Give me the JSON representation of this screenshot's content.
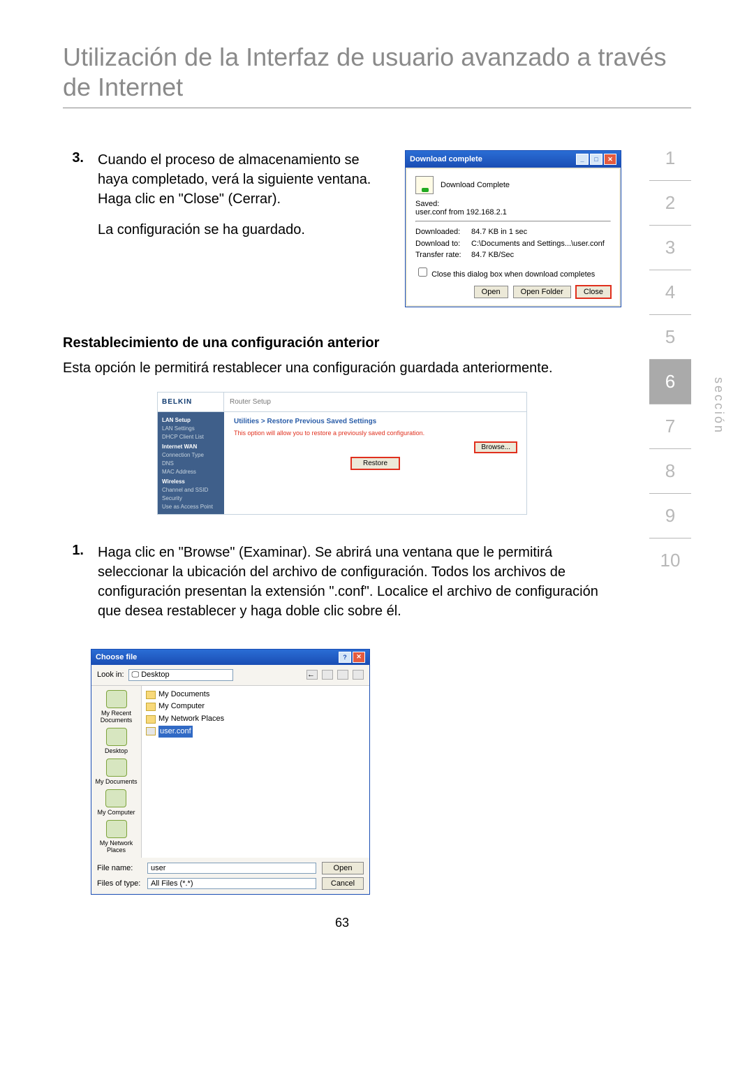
{
  "page": {
    "title": "Utilización de la Interfaz de usuario avanzado a través de Internet",
    "number": "63",
    "section_label": "sección"
  },
  "nav": {
    "items": [
      "1",
      "2",
      "3",
      "4",
      "5",
      "6",
      "7",
      "8",
      "9",
      "10"
    ],
    "active_index": 5
  },
  "step3": {
    "num": "3.",
    "para1": "Cuando el proceso de almacenamiento se haya completado, verá la siguiente ventana. Haga clic en \"Close\" (Cerrar).",
    "para2": "La configuración se ha guardado."
  },
  "download_dialog": {
    "title": "Download complete",
    "heading": "Download Complete",
    "saved_label": "Saved:",
    "saved_value": "user.conf from 192.168.2.1",
    "rows": [
      {
        "k": "Downloaded:",
        "v": "84.7 KB in 1 sec"
      },
      {
        "k": "Download to:",
        "v": "C:\\Documents and Settings...\\user.conf"
      },
      {
        "k": "Transfer rate:",
        "v": "84.7 KB/Sec"
      }
    ],
    "checkbox_label": "Close this dialog box when download completes",
    "btn_open": "Open",
    "btn_open_folder": "Open Folder",
    "btn_close": "Close"
  },
  "restore": {
    "heading": "Restablecimiento de una configuración anterior",
    "intro": "Esta opción le permitirá restablecer una configuración guardada anteriormente."
  },
  "router": {
    "logo": "BELKIN",
    "header": "Router Setup",
    "sidebar": {
      "cats": [
        {
          "cat": "LAN Setup",
          "items": [
            "LAN Settings",
            "DHCP Client List"
          ]
        },
        {
          "cat": "Internet WAN",
          "items": [
            "Connection Type",
            "DNS",
            "MAC Address"
          ]
        },
        {
          "cat": "Wireless",
          "items": [
            "Channel and SSID",
            "Security",
            "Use as Access Point"
          ]
        }
      ]
    },
    "crumb": "Utilities > Restore Previous Saved Settings",
    "desc": "This option will allow you to restore a previously saved configuration.",
    "browse": "Browse...",
    "restore": "Restore"
  },
  "step1": {
    "num": "1.",
    "text": "Haga clic en \"Browse\" (Examinar). Se abrirá una ventana que le permitirá seleccionar la ubicación del archivo de configuración. Todos los archivos de configuración presentan la extensión \".conf\". Localice el archivo de configuración que desea restablecer y haga doble clic sobre él."
  },
  "choose_file": {
    "title": "Choose file",
    "lookin_label": "Look in:",
    "lookin_value": "Desktop",
    "places": [
      "My Recent Documents",
      "Desktop",
      "My Documents",
      "My Computer",
      "My Network Places"
    ],
    "list": [
      "My Documents",
      "My Computer",
      "My Network Places",
      "user.conf"
    ],
    "selected_index": 3,
    "filename_label": "File name:",
    "filename_value": "user",
    "filetype_label": "Files of type:",
    "filetype_value": "All Files (*.*)",
    "btn_open": "Open",
    "btn_cancel": "Cancel"
  }
}
